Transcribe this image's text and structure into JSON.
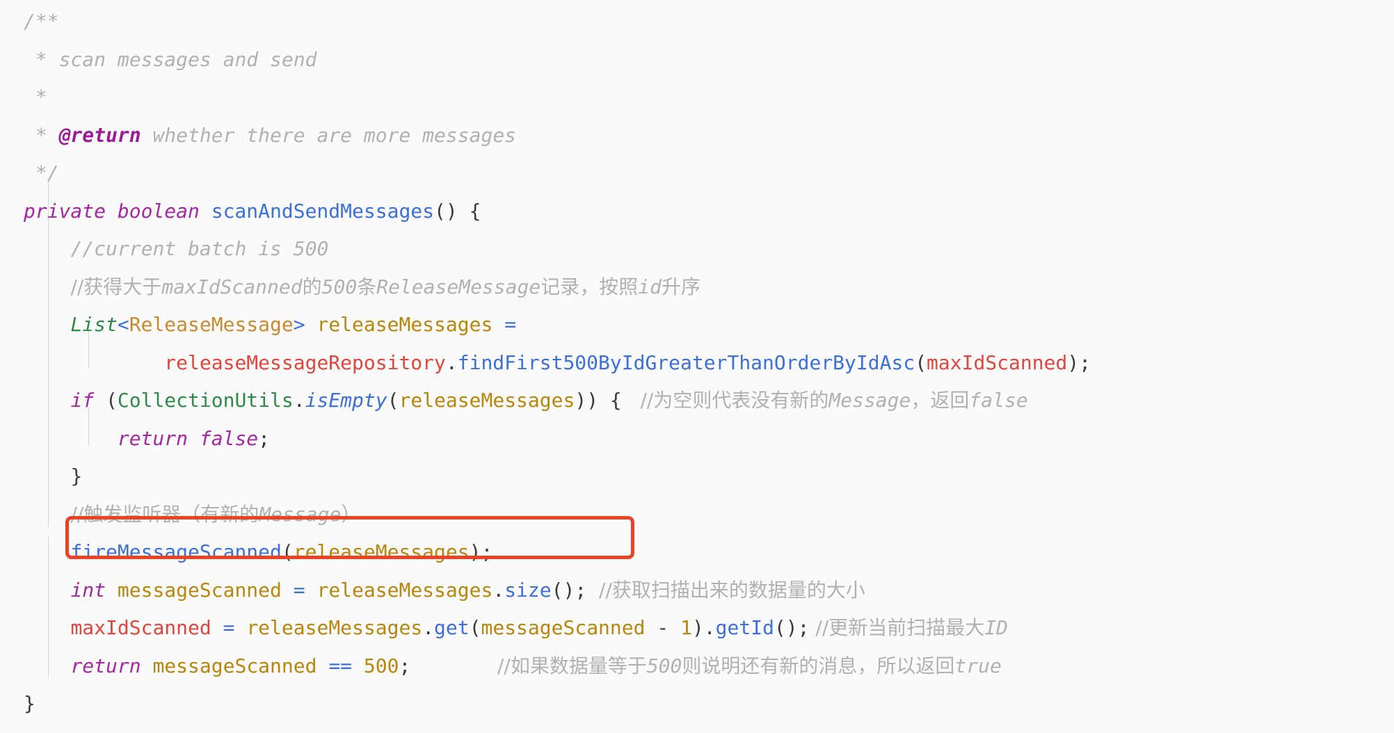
{
  "editor": {
    "language": "Java",
    "background_color": "#FAFAFA",
    "font_size_px": 28,
    "theme": "light"
  },
  "annotation": {
    "type": "rectangle-highlight",
    "color": "#EE4322",
    "border_width_px": 5,
    "target_line_text": "fireMessageScanned(releaseMessages);"
  },
  "palette": {
    "keyword": "#A626A4",
    "method": "#3B6FE0",
    "class": "#2E8B45",
    "type": "#C98A2E",
    "variable": "#B8860B",
    "field": "#E2453C",
    "number": "#B8860B",
    "operator": "#3B6FE0",
    "punctuation": "#3A3A3A",
    "comment": "#AFB1B3",
    "javadoc_tag": "#9B1C9B",
    "highlight_box": "#EE4322",
    "indent_guide": "#D6D6D6"
  },
  "code": {
    "javadoc_open": "/**",
    "javadoc_star_1": " * ",
    "javadoc_desc": "scan messages and send",
    "javadoc_star_2": " * ",
    "javadoc_star_3": " * ",
    "javadoc_tag": "@return",
    "javadoc_tag_desc": " whether there are more messages",
    "javadoc_close": " */",
    "sig_kw1": "private ",
    "sig_kw2": "boolean ",
    "sig_name": "scanAndSendMessages",
    "sig_tail": "() {",
    "comment_batch": "//current batch is 500",
    "comment_fetch_1": "//获得大于",
    "comment_fetch_2": "maxIdScanned",
    "comment_fetch_3": "的",
    "comment_fetch_4": "500",
    "comment_fetch_5": "条",
    "comment_fetch_6": "ReleaseMessage",
    "comment_fetch_7": "记录，按照",
    "comment_fetch_8": "id",
    "comment_fetch_9": "升序",
    "decl_list": "List",
    "decl_lt": "<",
    "decl_generic": "ReleaseMessage",
    "decl_gt": "> ",
    "decl_var": "releaseMessages",
    "decl_eq": " =",
    "repo_field": "releaseMessageRepository",
    "repo_dot": ".",
    "repo_method": "findFirst500ByIdGreaterThanOrderByIdAsc",
    "repo_open": "(",
    "repo_arg": "maxIdScanned",
    "repo_close": ");",
    "if_kw": "if ",
    "if_open": "(",
    "if_class": "CollectionUtils",
    "if_dot": ".",
    "if_method": "isEmpty",
    "if_arg_open": "(",
    "if_arg": "releaseMessages",
    "if_close": ")) {",
    "if_comment_1": "   //为空则代表没有新的",
    "if_comment_2": "Message",
    "if_comment_3": "，返回",
    "if_comment_4": "false",
    "return_false_kw": "return ",
    "return_false_val": "false",
    "return_false_semi": ";",
    "brace_close_if": "}",
    "comment_fire_1": "//触发监听器（有新的",
    "comment_fire_2": "Message",
    "comment_fire_3": "）",
    "fire_method": "fireMessageScanned",
    "fire_open": "(",
    "fire_arg": "releaseMessages",
    "fire_close": ");",
    "int_kw": "int ",
    "int_var": "messageScanned",
    "int_eq": " = ",
    "int_obj": "releaseMessages",
    "int_dot": ".",
    "int_method": "size",
    "int_tail": "();",
    "int_comment": "  //获取扫描出来的数据量的大小",
    "max_field": "maxIdScanned",
    "max_eq": " = ",
    "max_obj": "releaseMessages",
    "max_dot1": ".",
    "max_get": "get",
    "max_open": "(",
    "max_arg": "messageScanned",
    "max_minus": " - ",
    "max_num": "1",
    "max_close": ")",
    "max_dot2": ".",
    "max_getid": "getId",
    "max_tail": "();",
    "max_comment_1": " //更新当前扫描最大",
    "max_comment_2": "ID",
    "ret_kw": "return ",
    "ret_var": "messageScanned",
    "ret_op": " == ",
    "ret_num": "500",
    "ret_semi": ";",
    "ret_comment_1": "              //如果数据量等于",
    "ret_comment_2": "500",
    "ret_comment_3": "则说明还有新的消息，所以返回",
    "ret_comment_4": "true",
    "method_close": "}"
  }
}
